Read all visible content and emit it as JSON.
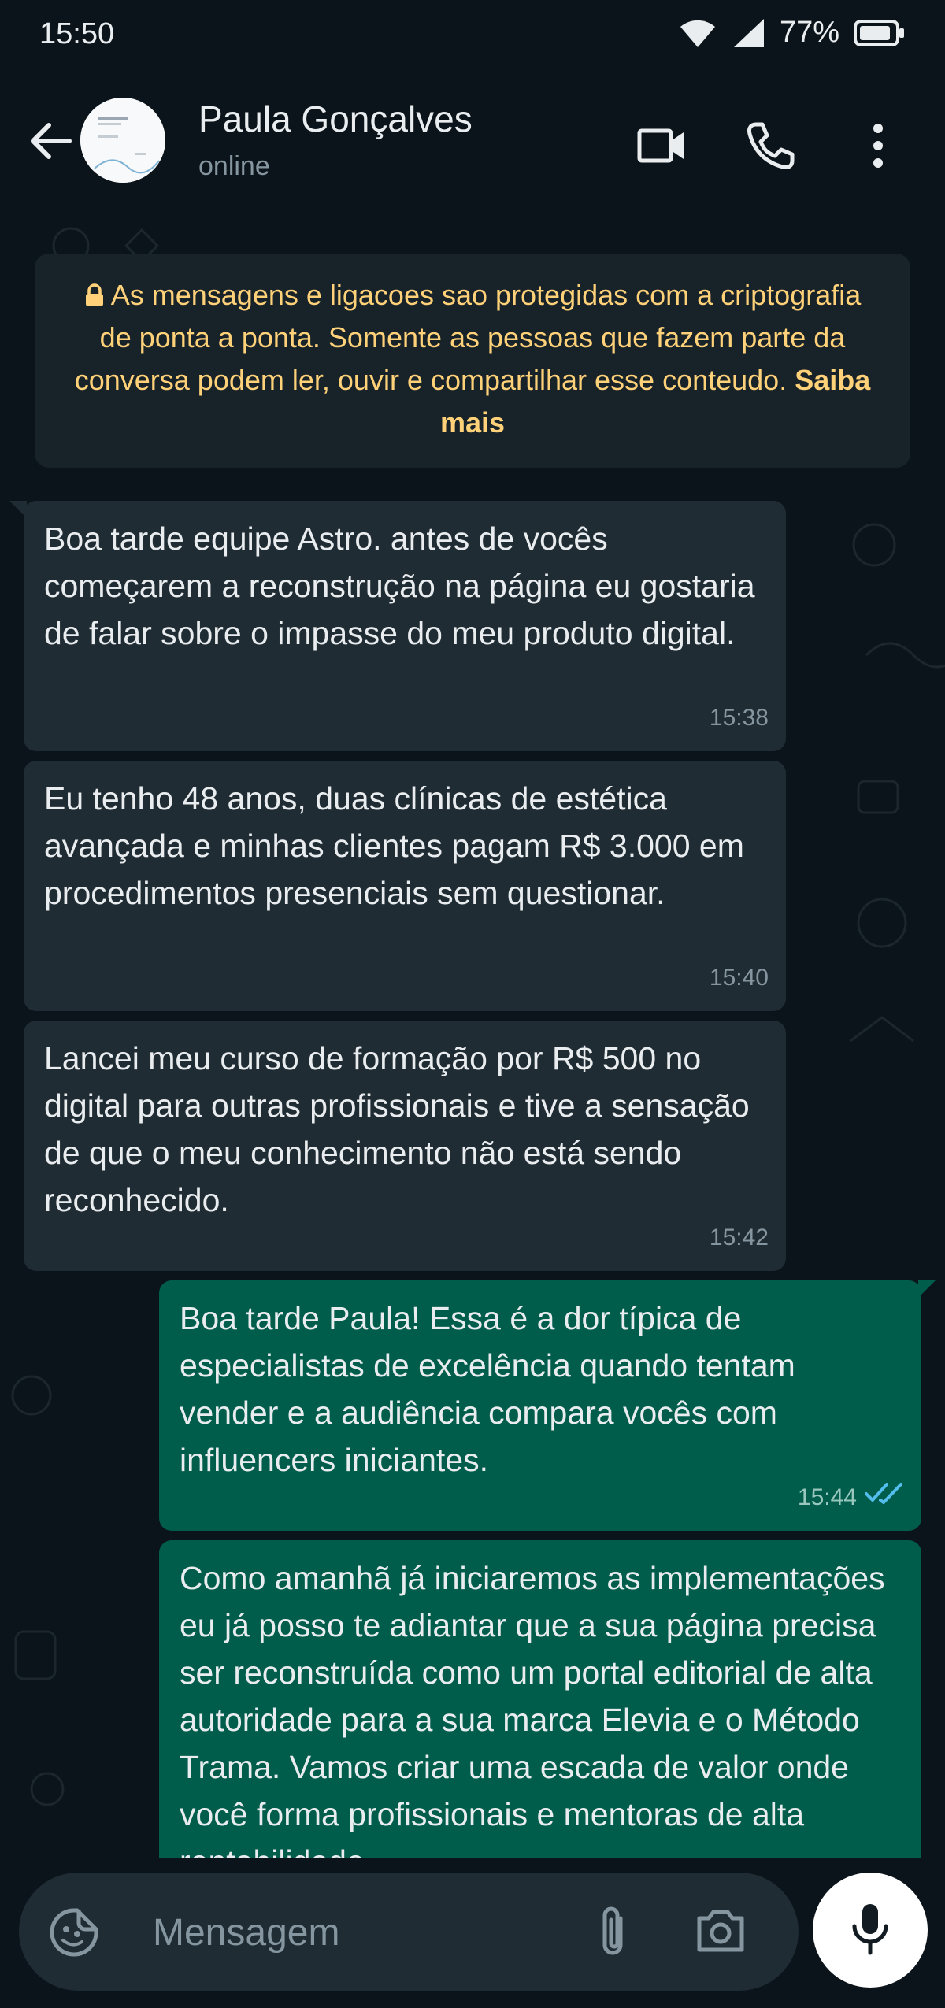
{
  "status_bar": {
    "time": "15:50",
    "battery": "77%"
  },
  "header": {
    "contact_name": "Paula Gonçalves",
    "status": "online",
    "icons": [
      "back-arrow-icon",
      "video-call-icon",
      "phone-icon",
      "more-vert-icon"
    ]
  },
  "notice": {
    "text": "As mensagens e ligacoes sao protegidas com a criptografia de ponta a ponta. Somente as pessoas que fazem parte da conversa podem ler, ouvir e compartilhar esse conteudo.",
    "link": "Saiba mais",
    "color": "#ffd279"
  },
  "messages": [
    {
      "direction": "incoming",
      "text": "Boa tarde equipe Astro. antes de vocês começarem a reconstrução na página eu gostaria de falar sobre o impasse do meu produto digital.",
      "time": "15:38"
    },
    {
      "direction": "incoming",
      "text": "Eu tenho 48 anos, duas clínicas de estética avançada e minhas clientes pagam R$ 3.000 em procedimentos presenciais sem questionar.",
      "time": "15:40"
    },
    {
      "direction": "incoming",
      "text": "Lancei meu curso de formação por R$ 500 no digital para outras profissionais e tive a sensação de que o meu conhecimento não está sendo reconhecido.",
      "time": "15:42"
    },
    {
      "direction": "outgoing",
      "text": "Boa tarde Paula! Essa é a dor típica de especialistas de excelência quando tentam vender e a audiência compara vocês com influencers iniciantes.",
      "time": "15:44",
      "read": true
    },
    {
      "direction": "outgoing",
      "text": "Como amanhã já iniciaremos as implementações eu já posso te adiantar que a sua página precisa ser reconstruída como um portal editorial de alta autoridade para a sua marca Elevia e o Método Trama. Vamos criar uma escada de valor onde você forma profissionais e mentoras de alta rentabilidade"
    }
  ],
  "composer": {
    "placeholder": "Mensagem"
  },
  "colors": {
    "background": "#0b141a",
    "incoming_bubble": "#202c33",
    "outgoing_bubble": "#005c4b",
    "read_ticks": "#53bdeb"
  }
}
